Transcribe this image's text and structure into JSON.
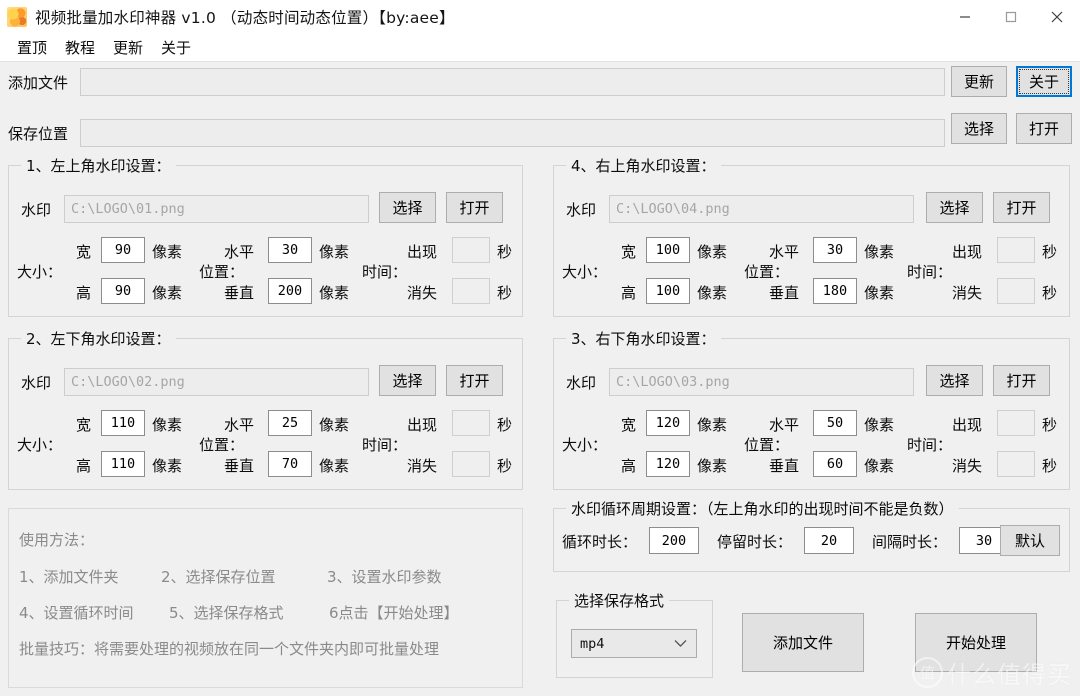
{
  "window": {
    "title": "视频批量加水印神器 v1.0  （动态时间动态位置）【by:aee】",
    "icon": "app-icon",
    "minimize_label": "—",
    "maximize_label": "□",
    "close_label": "✕"
  },
  "menu": {
    "items": [
      {
        "label": "置顶"
      },
      {
        "label": "教程"
      },
      {
        "label": "更新"
      },
      {
        "label": "关于"
      }
    ]
  },
  "toolbar": {
    "add_file_label": "添加文件",
    "add_file_value": "",
    "add_file_placeholder": "",
    "update_button": "更新",
    "about_button": "关于",
    "save_location_label": "保存位置",
    "save_location_value": "",
    "save_location_placeholder": "",
    "choose_button": "选择",
    "open_button": "打开"
  },
  "common": {
    "watermark_label": "水印",
    "choose_button": "选择",
    "open_button": "打开",
    "size_label": "大小：",
    "position_label": "位置：",
    "time_label": "时间：",
    "width_label": "宽",
    "height_label": "高",
    "horizontal_label": "水平",
    "vertical_label": "垂直",
    "appear_label": "出现",
    "disappear_label": "消失",
    "pixel_unit": "像素",
    "second_unit": "秒"
  },
  "groups": [
    {
      "legend": "1、左上角水印设置：",
      "path_placeholder": "C:\\LOGO\\01.png",
      "width": "90",
      "height": "90",
      "horizontal": "30",
      "vertical": "200",
      "appear": "",
      "disappear": ""
    },
    {
      "legend": "4、右上角水印设置：",
      "path_placeholder": "C:\\LOGO\\04.png",
      "width": "100",
      "height": "100",
      "horizontal": "30",
      "vertical": "180",
      "appear": "",
      "disappear": ""
    },
    {
      "legend": "2、左下角水印设置：",
      "path_placeholder": "C:\\LOGO\\02.png",
      "width": "110",
      "height": "110",
      "horizontal": "25",
      "vertical": "70",
      "appear": "",
      "disappear": ""
    },
    {
      "legend": "3、右下角水印设置：",
      "path_placeholder": "C:\\LOGO\\03.png",
      "width": "120",
      "height": "120",
      "horizontal": "50",
      "vertical": "60",
      "appear": "",
      "disappear": ""
    }
  ],
  "howto": {
    "title": "使用方法：",
    "line1_a": "1、添加文件夹",
    "line1_b": "2、选择保存位置",
    "line1_c": "3、设置水印参数",
    "line2_a": "4、设置循环时间",
    "line2_b": "5、选择保存格式",
    "line2_c": "6点击【开始处理】",
    "line3": "批量技巧：将需要处理的视频放在同一个文件夹内即可批量处理"
  },
  "loop": {
    "legend": "水印循环周期设置：（左上角水印的出现时间不能是负数）",
    "cycle_label": "循环时长：",
    "cycle_value": "200",
    "stay_label": "停留时长：",
    "stay_value": "20",
    "interval_label": "间隔时长：",
    "interval_value": "30",
    "default_button": "默认"
  },
  "format": {
    "legend": "选择保存格式",
    "selected": "mp4"
  },
  "actions": {
    "add_file_button": "添加文件",
    "start_button": "开始处理"
  },
  "overlay_watermark": {
    "badge": "值",
    "text": "什么值得买"
  },
  "colors": {
    "background": "#f0f0f0",
    "accent": "#0078d7",
    "button_face": "#e1e1e1",
    "hint_text": "#8a8a8a"
  }
}
